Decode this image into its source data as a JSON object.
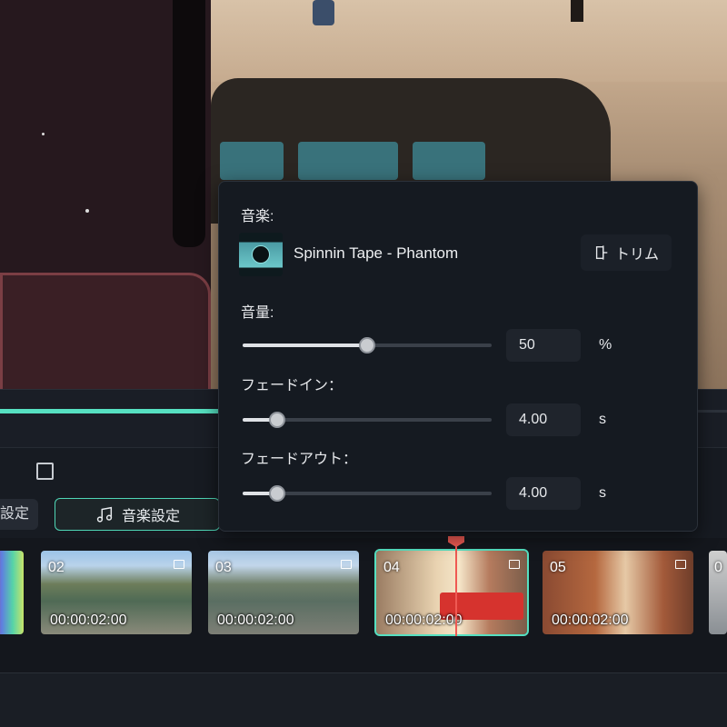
{
  "popup": {
    "music_label": "音楽:",
    "track_name": "Spinnin Tape - Phantom",
    "trim_label": "トリム",
    "volume_label": "音量:",
    "volume_value": "50",
    "volume_unit": "%",
    "volume_level": 0.5,
    "fade_in_label": "フェードイン：",
    "fade_in_value": "4.00",
    "fade_in_unit": "s",
    "fade_in_level": 0.14,
    "fade_out_label": "フェードアウト：",
    "fade_out_value": "4.00",
    "fade_out_unit": "s",
    "fade_out_level": 0.14
  },
  "toolbar": {
    "settings_label": "設定",
    "music_settings_label": "音楽設定"
  },
  "playback": {
    "progress": 0.3
  },
  "timeline": {
    "clips": [
      {
        "number": "02",
        "duration": "00:00:02:00"
      },
      {
        "number": "03",
        "duration": "00:00:02:00"
      },
      {
        "number": "04",
        "duration": "00:00:02:00"
      },
      {
        "number": "05",
        "duration": "00:00:02:00"
      },
      {
        "number": "0",
        "duration": ""
      }
    ]
  },
  "colors": {
    "accent": "#56e0c1",
    "playhead": "#ef5a53",
    "panel": "#151a21"
  }
}
